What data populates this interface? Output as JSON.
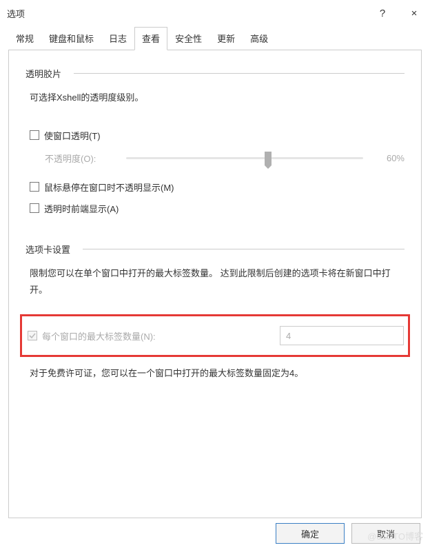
{
  "window": {
    "title": "选项",
    "help_symbol": "?",
    "close_symbol": "×"
  },
  "tabs": [
    "常规",
    "键盘和鼠标",
    "日志",
    "查看",
    "安全性",
    "更新",
    "高级"
  ],
  "active_tab_index": 3,
  "section_transparency": {
    "title": "透明胶片",
    "desc": "可选择Xshell的透明度级别。",
    "cb_make_transparent": "使窗口透明(T)",
    "opacity_label": "不透明度(O):",
    "opacity_value": "60%",
    "cb_hover_opaque": "鼠标悬停在窗口时不透明显示(M)",
    "cb_always_top": "透明时前端显示(A)"
  },
  "section_tabs": {
    "title": "选项卡设置",
    "desc": "限制您可以在单个窗口中打开的最大标签数量。 达到此限制后创建的选项卡将在新窗口中打开。",
    "cb_max_tabs_label": "每个窗口的最大标签数量(N):",
    "max_tabs_value": "4",
    "note": "对于免费许可证，您可以在一个窗口中打开的最大标签数量固定为4。"
  },
  "buttons": {
    "ok": "确定",
    "cancel": "取消"
  },
  "watermark": "@51CTO博客"
}
